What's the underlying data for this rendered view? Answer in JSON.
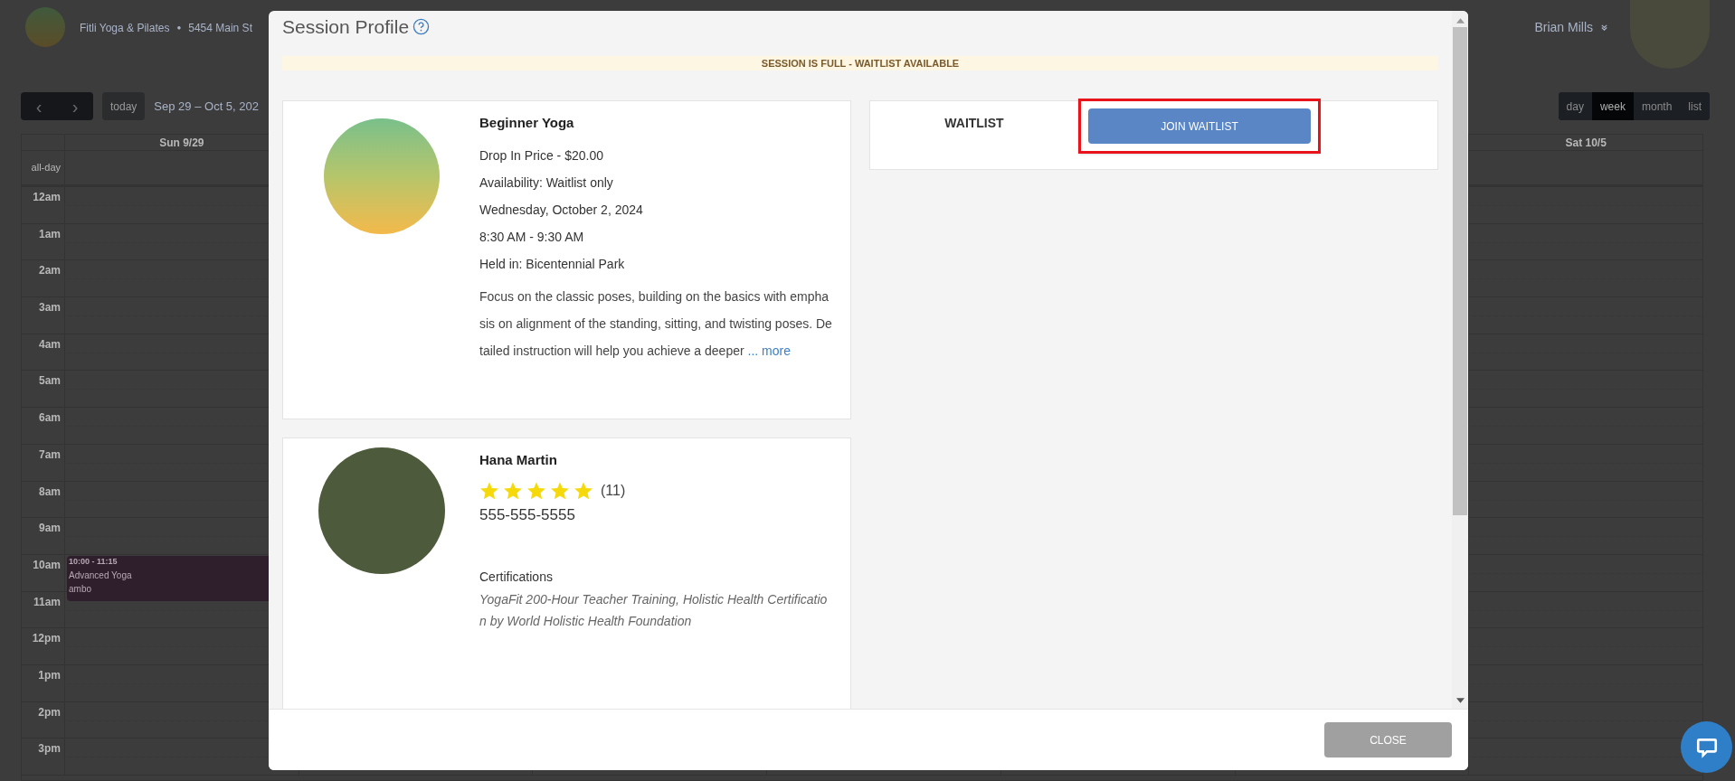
{
  "header": {
    "studio_name": "Fitli Yoga & Pilates",
    "separator": "●",
    "address": "5454 Main St",
    "user_name": "Brian Mills"
  },
  "toolbar": {
    "prev": "‹",
    "next": "›",
    "today": "today",
    "date_range": "Sep 29 – Oct 5, 202",
    "views": [
      {
        "label": "day",
        "selected": false
      },
      {
        "label": "week",
        "selected": true
      },
      {
        "label": "month",
        "selected": false
      },
      {
        "label": "list",
        "selected": false
      }
    ]
  },
  "calendar": {
    "columns": [
      "Sun 9/29",
      "",
      "",
      "",
      "",
      "",
      "Sat 10/5"
    ],
    "all_day": "all-day",
    "hours": [
      "12am",
      "1am",
      "2am",
      "3am",
      "4am",
      "5am",
      "6am",
      "7am",
      "8am",
      "9am",
      "10am",
      "11am",
      "12pm",
      "1pm",
      "2pm",
      "3pm"
    ],
    "events": [
      {
        "time": "10:00 - 11:15",
        "title": "Advanced Yoga",
        "location": "ambo"
      }
    ]
  },
  "modal": {
    "title": "Session Profile",
    "banner": "SESSION IS FULL - WAITLIST AVAILABLE",
    "session": {
      "name": "Beginner Yoga",
      "details": [
        "Drop In Price - $20.00",
        "Availability: Waitlist only",
        "Wednesday, October 2, 2024",
        "8:30 AM - 9:30 AM",
        "Held in: Bicentennial Park"
      ],
      "description": "Focus on the classic poses, building on the basics with emphasis on alignment of the standing, sitting, and twisting poses. Detailed instruction will help you achieve a deeper",
      "more_link": "... more"
    },
    "instructor": {
      "name": "Hana Martin",
      "stars": 5,
      "review_count": "(11)",
      "phone": "555-555-5555",
      "certifications_label": "Certifications",
      "certifications": "YogaFit 200-Hour Teacher Training, Holistic Health Certification by World Holistic Health Foundation"
    },
    "waitlist": {
      "label": "WAITLIST",
      "button": "JOIN WAITLIST",
      "highlighted": true
    },
    "close_button": "CLOSE"
  }
}
